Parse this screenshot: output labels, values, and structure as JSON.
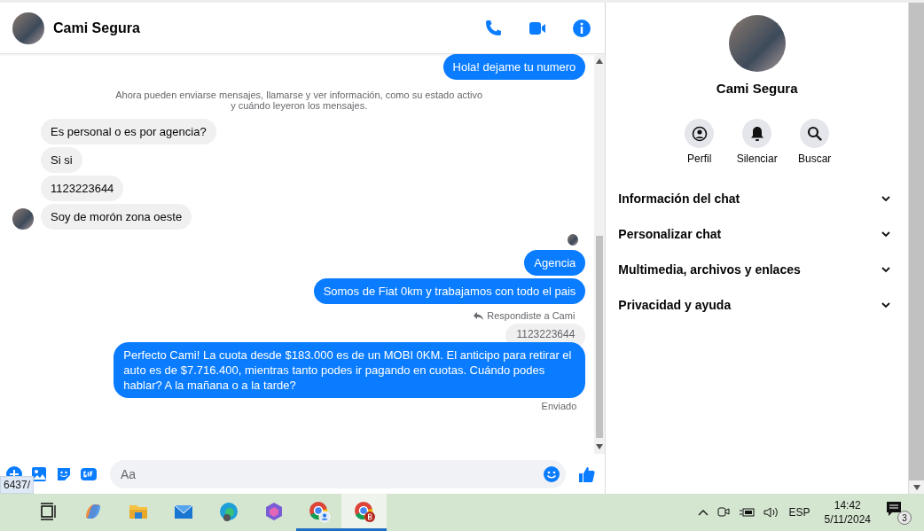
{
  "chat": {
    "contact_name": "Cami Segura",
    "messages": [
      {
        "kind": "outgoing",
        "text": "Hola! dejame tu numero"
      },
      {
        "kind": "system",
        "text": "Ahora pueden enviarse mensajes, llamarse y ver información, como su estado activo y cuándo leyeron los mensajes."
      },
      {
        "kind": "incoming",
        "text": "Es personal o es por agencia?",
        "avatar": false
      },
      {
        "kind": "incoming",
        "text": "Si si",
        "avatar": false
      },
      {
        "kind": "incoming",
        "text": "1123223644",
        "avatar": false
      },
      {
        "kind": "incoming",
        "text": "Soy de morón zona oeste",
        "avatar": true
      },
      {
        "kind": "seen"
      },
      {
        "kind": "outgoing",
        "text": "Agencia"
      },
      {
        "kind": "outgoing",
        "text": "Somos de Fiat 0km y trabajamos con todo el pais"
      },
      {
        "kind": "reply_note",
        "text": "Respondiste a Cami"
      },
      {
        "kind": "quote",
        "text": "1123223644"
      },
      {
        "kind": "outgoing",
        "text": "Perfecto Cami!  La cuota desde $183.000 es de un MOBI 0KM. El anticipo para retirar el auto es de $7.716.400, mientras tanto podes ir pagando en cuotas. Cuándo podes hablar? A la mañana o a la tarde?"
      },
      {
        "kind": "status",
        "text": "Enviado"
      }
    ],
    "composer": {
      "placeholder": "Aa"
    },
    "tooltip": "6437/"
  },
  "details": {
    "name": "Cami Segura",
    "actions": [
      {
        "kind": "profile",
        "label": "Perfil"
      },
      {
        "kind": "mute",
        "label": "Silenciar"
      },
      {
        "kind": "search",
        "label": "Buscar"
      }
    ],
    "sections": [
      {
        "label": "Información del chat",
        "expanded": false
      },
      {
        "label": "Personalizar chat",
        "expanded": false
      },
      {
        "label": "Multimedia, archivos y enlaces",
        "expanded": false
      },
      {
        "label": "Privacidad y ayuda",
        "expanded": false
      }
    ]
  },
  "taskbar": {
    "apps": [
      {
        "kind": "taskview",
        "active": false,
        "selected": false
      },
      {
        "kind": "copilot",
        "active": false,
        "selected": false
      },
      {
        "kind": "explorer",
        "active": false,
        "selected": false
      },
      {
        "kind": "mail",
        "active": false,
        "selected": false
      },
      {
        "kind": "edge",
        "active": false,
        "selected": false
      },
      {
        "kind": "m365",
        "active": false,
        "selected": false
      },
      {
        "kind": "chrome-person",
        "active": true,
        "selected": false
      },
      {
        "kind": "chrome-b",
        "active": true,
        "selected": true
      }
    ],
    "language": "ESP",
    "time": "14:42",
    "date": "5/11/2024",
    "notifications": "3"
  }
}
